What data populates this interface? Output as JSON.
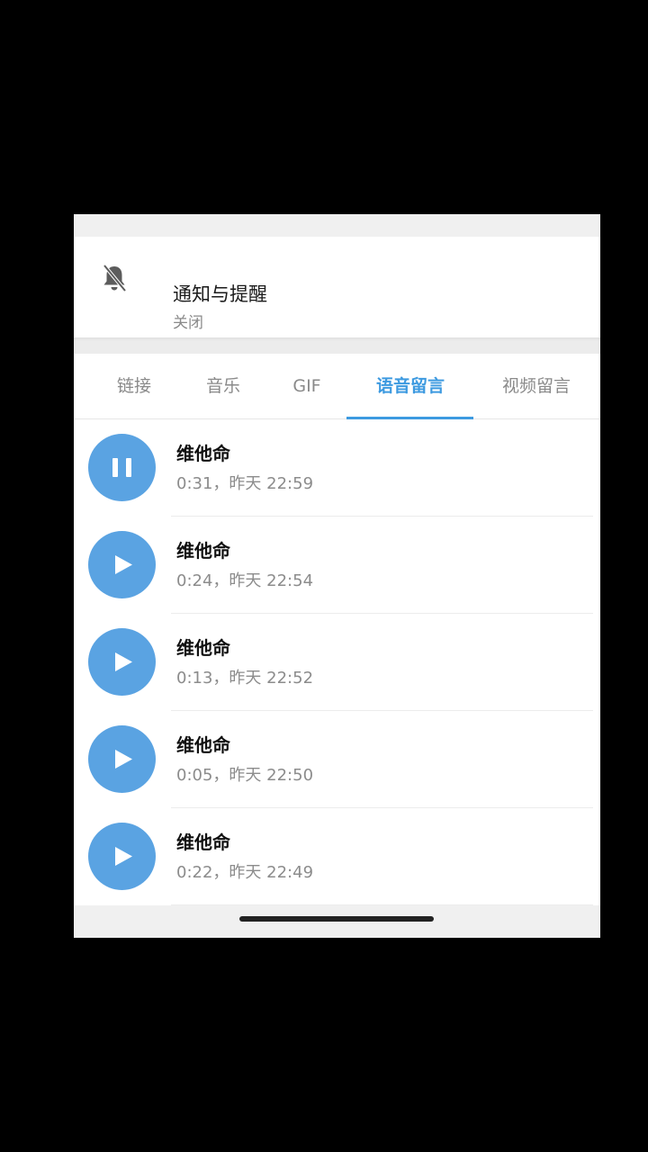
{
  "notification": {
    "title": "通知与提醒",
    "status": "关闭",
    "icon": "bell-off-icon"
  },
  "tabs": [
    {
      "label": "链接",
      "active": false
    },
    {
      "label": "音乐",
      "active": false
    },
    {
      "label": "GIF",
      "active": false
    },
    {
      "label": "语音留言",
      "active": true
    },
    {
      "label": "视频留言",
      "active": false
    }
  ],
  "voice_messages": [
    {
      "title": "维他命",
      "meta": "0:31，昨天 22:59",
      "state": "pause-icon"
    },
    {
      "title": "维他命",
      "meta": "0:24，昨天 22:54",
      "state": "play-icon"
    },
    {
      "title": "维他命",
      "meta": "0:13，昨天 22:52",
      "state": "play-icon"
    },
    {
      "title": "维他命",
      "meta": "0:05，昨天 22:50",
      "state": "play-icon"
    },
    {
      "title": "维他命",
      "meta": "0:22，昨天 22:49",
      "state": "play-icon"
    }
  ],
  "colors": {
    "accent": "#3d9ae0",
    "play_button": "#5aa3e2"
  }
}
